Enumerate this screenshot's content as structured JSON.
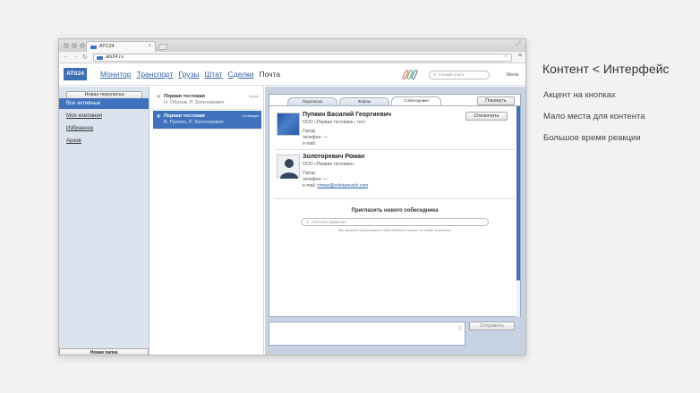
{
  "browser": {
    "tab_title": "АТС24",
    "url": "ats24.ru"
  },
  "app": {
    "logo": "ATS24",
    "nav": [
      "Монитор",
      "Транспорт",
      "Грузы",
      "Штат",
      "Сделки",
      "Почта"
    ],
    "active_nav": "Почта",
    "search_placeholder": "Слежий поиск",
    "user": "Меню",
    "clip_colors": [
      "#e05a5a",
      "#4caf50",
      "#3e72bd"
    ]
  },
  "sidebar": {
    "new_conversation": "Новая переписка",
    "items": [
      "Все активные",
      "Моя компания",
      "Избранное",
      "Архив"
    ],
    "new_folder": "Новая папка"
  },
  "threads": [
    {
      "title": "Первая тестовая",
      "participants": "Н. Обухов, Р. Золоторевич",
      "date": "вчера",
      "selected": false
    },
    {
      "title": "Первая тестовая",
      "participants": "В. Пупкин, Р. Золоторевич",
      "date": "15 января",
      "selected": true
    }
  ],
  "conversation": {
    "tabs": [
      "Переписка",
      "Файлы",
      "Собеседники"
    ],
    "active_tab": "Собеседники",
    "leave_button": "Покинуть",
    "participants": [
      {
        "name": "Пупкин Василий Георгиевич",
        "company": "ООО «Первая тестовая», тест",
        "city": "Город:",
        "phone": "телефон: —",
        "email_label": "e-mail:",
        "email": "",
        "action": "Отключить"
      },
      {
        "name": "Золоторевич Роман",
        "company": "ООО «Первая тестовая»",
        "city": "Город:",
        "phone": "телефон: —",
        "email_label": "e-mail:",
        "email": "roman@zolotarevich.com",
        "action": ""
      }
    ],
    "invite_title": "Пригласить нового собеседника",
    "invite_placeholder": "Имя или фамилия",
    "invite_note": "Вы можете приглашать собеседников только из своей компании",
    "send_button": "Отправить"
  },
  "slide": {
    "title": "Контент < Интерфейс",
    "points": [
      "Акцент на кнопках",
      "Мало места для контента",
      "Большое время реакции"
    ]
  }
}
